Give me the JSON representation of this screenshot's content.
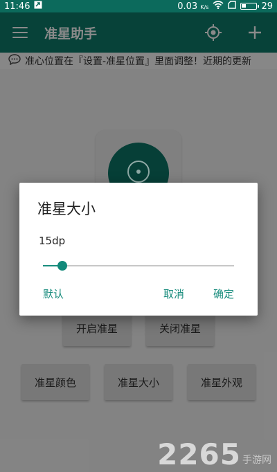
{
  "status_bar": {
    "time": "11:46",
    "speed": "0.03",
    "speed_unit": "K/s",
    "battery": "29",
    "battery_level": 0.29
  },
  "toolbar": {
    "title": "准星助手",
    "menu_icon": "hamburger-menu-icon",
    "crosshair_icon": "crosshair-target-icon",
    "add_icon": "plus-icon"
  },
  "notice": {
    "icon": "chat-bubble-icon",
    "text": "准心位置在『设置-准星位置』里面调整！近期的更新"
  },
  "buttons": {
    "open_crosshair": "开启准星",
    "close_crosshair": "关闭准星",
    "crosshair_color": "准星颜色",
    "crosshair_size": "准星大小",
    "crosshair_style": "准星外观"
  },
  "dialog": {
    "title": "准星大小",
    "value": "15dp",
    "slider_fraction": 0.1,
    "default_label": "默认",
    "cancel_label": "取消",
    "confirm_label": "确定"
  },
  "watermark": {
    "number": "2265",
    "text": "手游网"
  },
  "colors": {
    "toolbar": "#0e7a69",
    "status_bar": "#0c6a5c",
    "accent": "#1a8d7e"
  }
}
